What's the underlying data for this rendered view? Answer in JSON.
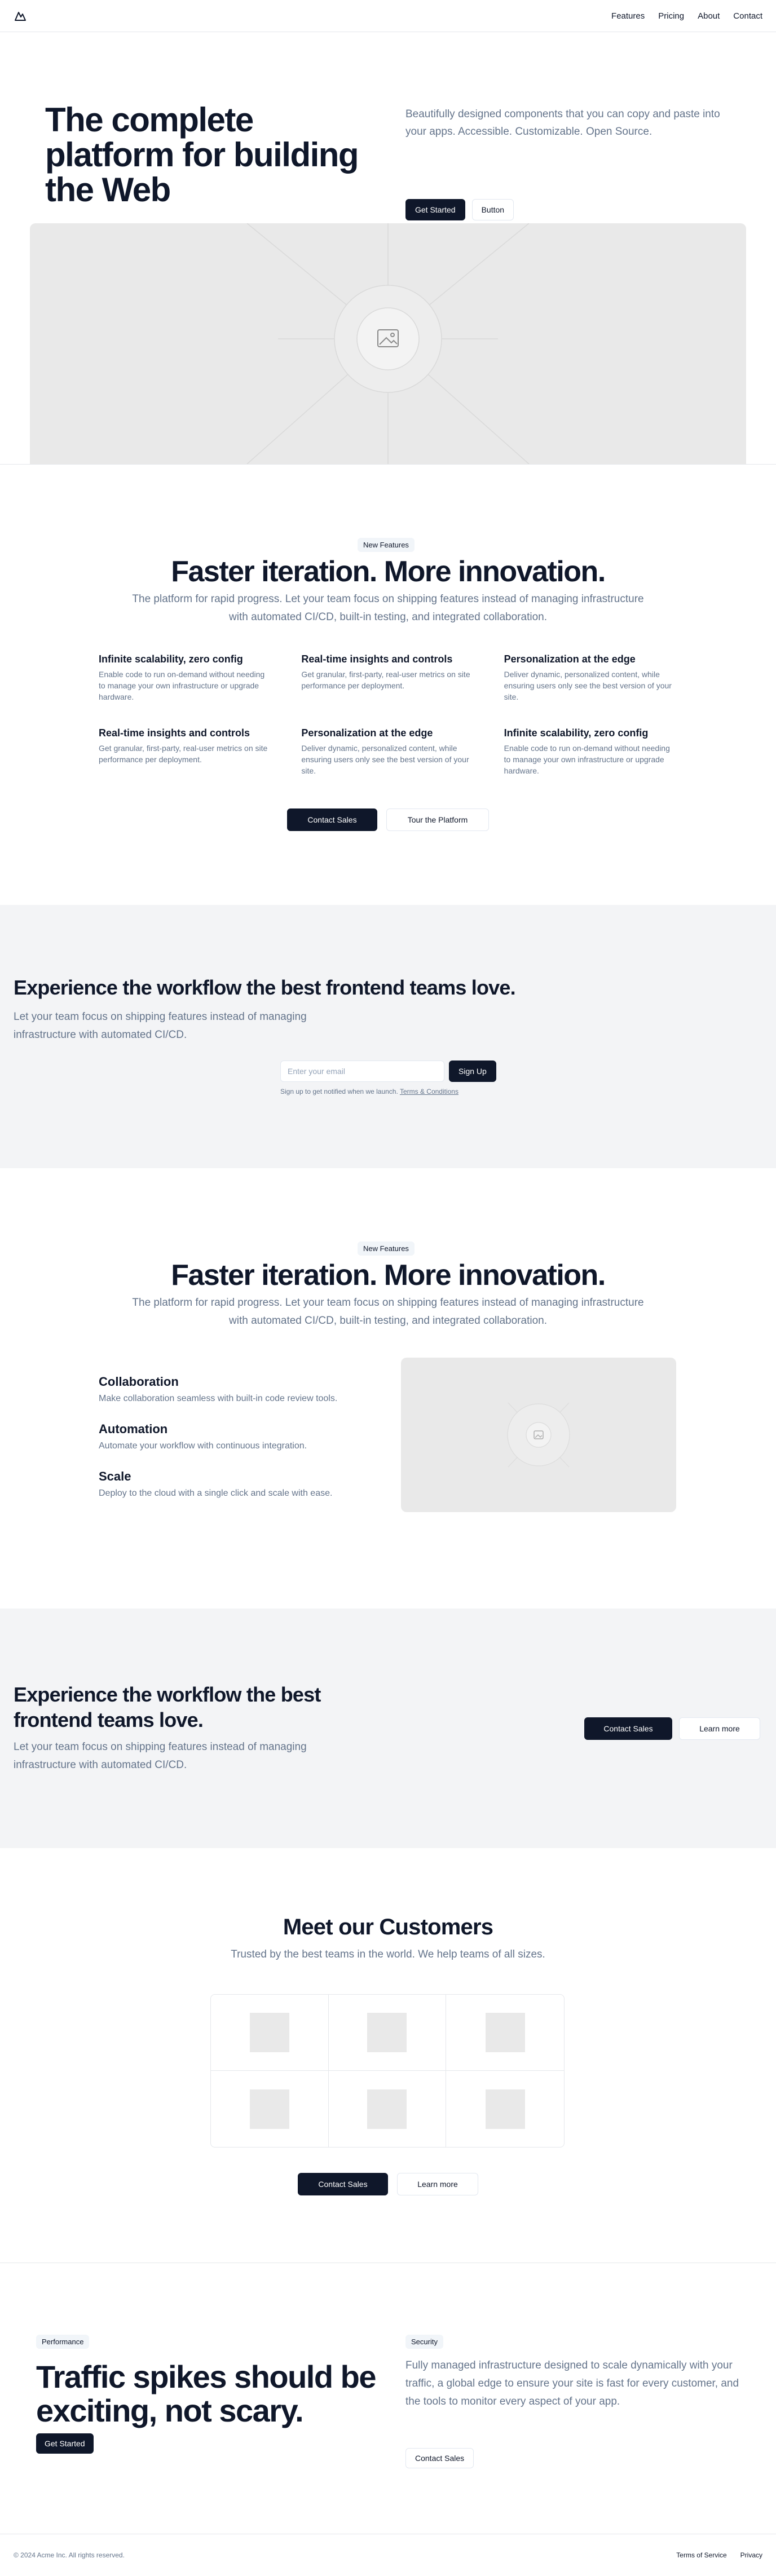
{
  "nav": {
    "logo": "mountain-logo",
    "links": [
      "Features",
      "Pricing",
      "About",
      "Contact"
    ]
  },
  "hero": {
    "title": "The complete platform for building the Web",
    "description": "Beautifully designed components that you can copy and paste into your apps. Accessible. Customizable. Open Source.",
    "primary_button": "Get Started",
    "secondary_button": "Button",
    "image": "placeholder-image-icon"
  },
  "features": {
    "badge": "New Features",
    "title": "Faster iteration. More innovation.",
    "subtitle": "The platform for rapid progress. Let your team focus on shipping features instead of managing infrastructure with automated CI/CD, built-in testing, and integrated collaboration.",
    "items": [
      {
        "title": "Infinite scalability, zero config",
        "text": "Enable code to run on-demand without needing to manage your own infrastructure or upgrade hardware."
      },
      {
        "title": "Real-time insights and controls",
        "text": "Get granular, first-party, real-user metrics on site performance per deployment."
      },
      {
        "title": "Personalization at the edge",
        "text": "Deliver dynamic, personalized content, while ensuring users only see the best version of your site."
      },
      {
        "title": "Real-time insights and controls",
        "text": "Get granular, first-party, real-user metrics on site performance per deployment."
      },
      {
        "title": "Personalization at the edge",
        "text": "Deliver dynamic, personalized content, while ensuring users only see the best version of your site."
      },
      {
        "title": "Infinite scalability, zero config",
        "text": "Enable code to run on-demand without needing to manage your own infrastructure or upgrade hardware."
      }
    ],
    "primary_button": "Contact Sales",
    "secondary_button": "Tour the Platform"
  },
  "workflow_signup": {
    "title": "Experience the workflow the best frontend teams love.",
    "description": "Let your team focus on shipping features instead of managing infrastructure with automated CI/CD.",
    "email_placeholder": "Enter your email",
    "signup_button": "Sign Up",
    "fineprint": "Sign up to get notified when we launch.",
    "terms_link": "Terms & Conditions"
  },
  "features2": {
    "badge": "New Features",
    "title": "Faster iteration. More innovation.",
    "subtitle": "The platform for rapid progress. Let your team focus on shipping features instead of managing infrastructure with automated CI/CD, built-in testing, and integrated collaboration.",
    "items": [
      {
        "title": "Collaboration",
        "text": "Make collaboration seamless with built-in code review tools."
      },
      {
        "title": "Automation",
        "text": "Automate your workflow with continuous integration."
      },
      {
        "title": "Scale",
        "text": "Deploy to the cloud with a single click and scale with ease."
      }
    ]
  },
  "workflow_cta": {
    "title": "Experience the workflow the best frontend teams love.",
    "description": "Let your team focus on shipping features instead of managing infrastructure with automated CI/CD.",
    "primary_button": "Contact Sales",
    "secondary_button": "Learn more"
  },
  "customers": {
    "title": "Meet our Customers",
    "subtitle": "Trusted by the best teams in the world. We help teams of all sizes.",
    "primary_button": "Contact Sales",
    "secondary_button": "Learn more"
  },
  "traffic": {
    "badge_left": "Performance",
    "title": "Traffic spikes should be exciting, not scary.",
    "primary_button": "Get Started",
    "badge_right": "Security",
    "description": "Fully managed infrastructure designed to scale dynamically with your traffic, a global edge to ensure your site is fast for every customer, and the tools to monitor every aspect of your app.",
    "secondary_button": "Contact Sales"
  },
  "footer": {
    "copyright": "© 2024 Acme Inc. All rights reserved.",
    "links": [
      "Terms of Service",
      "Privacy"
    ]
  }
}
